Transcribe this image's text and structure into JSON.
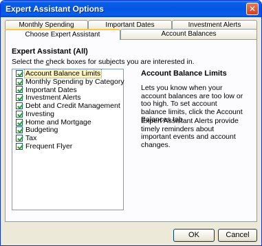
{
  "window": {
    "title": "Expert Assistant Options",
    "close_symbol": "✕"
  },
  "tabs_row1": [
    {
      "label": "Monthly Spending"
    },
    {
      "label": "Important Dates"
    },
    {
      "label": "Investment Alerts"
    }
  ],
  "tabs_row2": [
    {
      "label": "Choose Expert Assistant",
      "active": true
    },
    {
      "label": "Account Balances",
      "active": false
    }
  ],
  "panel": {
    "section_title": "Expert Assistant (All)",
    "instructions_pre": "Select the ",
    "instructions_hotkey": "c",
    "instructions_post": "heck boxes for subjects you are interested in.",
    "items": [
      {
        "label": "Account Balance Limits",
        "checked": true,
        "selected": true
      },
      {
        "label": "Monthly Spending by Category",
        "checked": true
      },
      {
        "label": "Important Dates",
        "checked": true
      },
      {
        "label": "Investment Alerts",
        "checked": true
      },
      {
        "label": "Debt and Credit Management",
        "checked": true
      },
      {
        "label": "Investing",
        "checked": true
      },
      {
        "label": "Home and Mortgage",
        "checked": true
      },
      {
        "label": "Budgeting",
        "checked": true
      },
      {
        "label": "Tax",
        "checked": true
      },
      {
        "label": "Frequent Flyer",
        "checked": true
      }
    ],
    "detail_title": "Account Balance Limits",
    "detail_description": "Lets you know when your account balances are too low or too high. To set account balance limits, click the Account Balances tab.",
    "detail_note": "Expert Assistant Alerts provide timely reminders about important events and account changes."
  },
  "buttons": {
    "ok": "OK",
    "cancel": "Cancel"
  }
}
